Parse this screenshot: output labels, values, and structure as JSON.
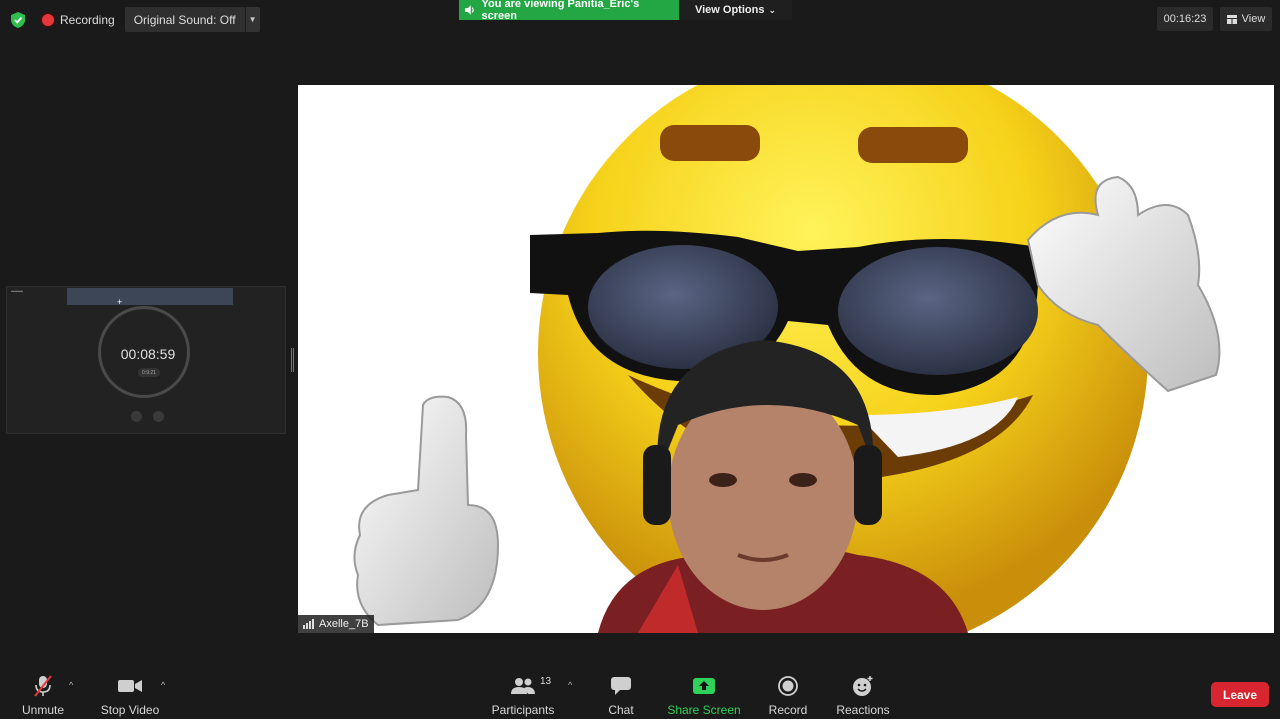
{
  "top_bar": {
    "recording_label": "Recording",
    "original_sound_label": "Original Sound: Off",
    "viewing_banner": "You are viewing Panitia_Eric's screen",
    "view_options_label": "View Options",
    "meeting_timer": "00:16:23",
    "view_label": "View"
  },
  "thumbnail": {
    "stopwatch_time": "00:08:59",
    "stopwatch_sub": "0:9:21"
  },
  "share": {
    "participant_name": "Axelle_7B"
  },
  "toolbar": {
    "unmute_label": "Unmute",
    "stop_video_label": "Stop Video",
    "participants_label": "Participants",
    "participants_count": "13",
    "chat_label": "Chat",
    "share_screen_label": "Share Screen",
    "record_label": "Record",
    "reactions_label": "Reactions",
    "leave_label": "Leave"
  },
  "colors": {
    "share_screen_green": "#23a745",
    "leave_red": "#d7262f",
    "recording_red": "#e5383b",
    "security_green": "#2fbf4f"
  },
  "icons": [
    "shield-icon",
    "recording-dot-icon",
    "speaker-icon",
    "chevron-down-icon",
    "grid-icon",
    "signal-icon",
    "mic-muted-icon",
    "video-camera-icon",
    "participants-icon",
    "chat-icon",
    "share-screen-icon",
    "record-icon",
    "reactions-icon"
  ]
}
